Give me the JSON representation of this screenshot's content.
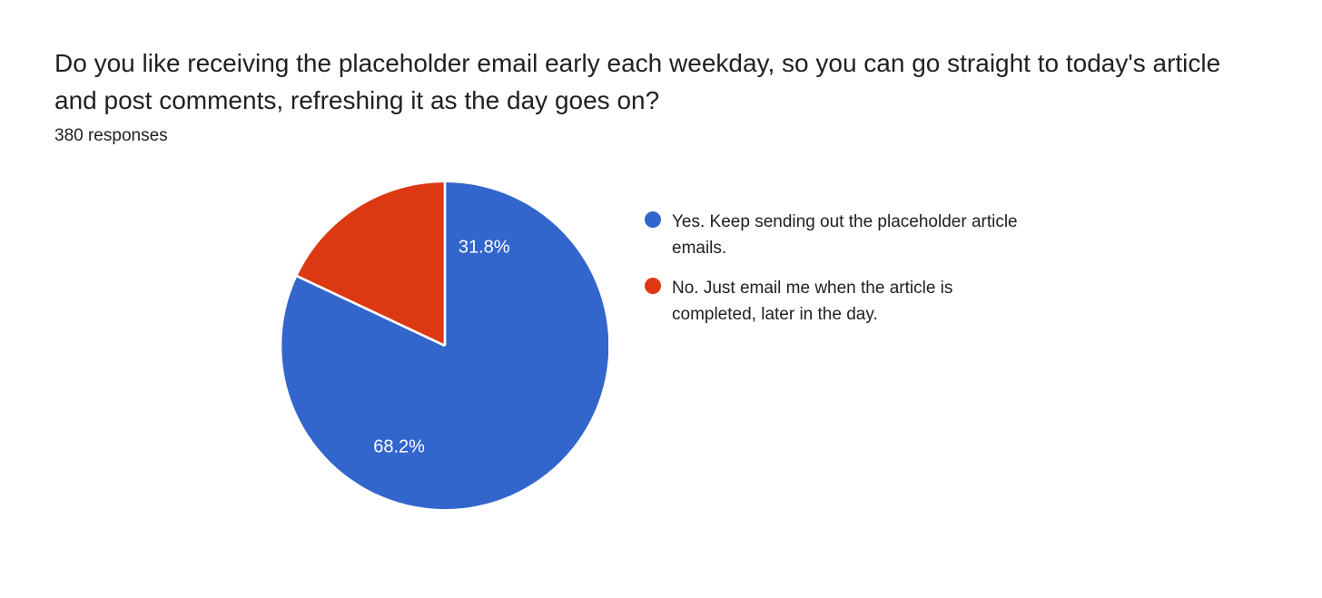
{
  "chart_data": {
    "type": "pie",
    "title": "Do you like receiving the placeholder email early each weekday, so you can go straight to today's article and post comments, refreshing it as the day goes on?",
    "subtitle": "380 responses",
    "series": [
      {
        "name": "Yes. Keep sending out the placeholder article emails.",
        "value": 68.2,
        "label": "68.2%",
        "color": "#3366cc"
      },
      {
        "name": "No. Just email me when the article is completed, later in the day.",
        "value": 31.8,
        "label": "31.8%",
        "color": "#dc3912"
      }
    ]
  }
}
